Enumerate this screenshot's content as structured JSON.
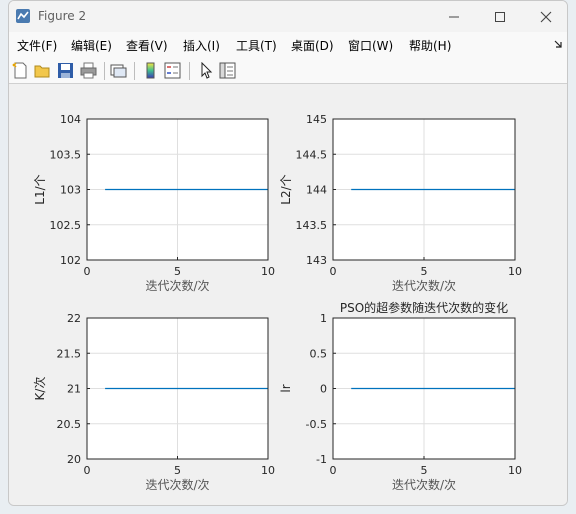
{
  "window": {
    "title": "Figure 2"
  },
  "menu": [
    "文件(F)",
    "编辑(E)",
    "查看(V)",
    "插入(I)",
    "工具(T)",
    "桌面(D)",
    "窗口(W)",
    "帮助(H)"
  ],
  "toolbar_icons": [
    "new-figure-icon",
    "open-file-icon",
    "save-icon",
    "print-icon",
    "link-plot-icon",
    "colorbar-icon",
    "legend-icon",
    "pointer-icon",
    "property-inspector-icon"
  ],
  "colors": {
    "line": "#0072bd",
    "grid": "#dfdfdf"
  },
  "chart_data": [
    {
      "type": "line",
      "title": "",
      "xlabel": "迭代次数/次",
      "ylabel": "L1/个",
      "xlim": [
        0,
        10
      ],
      "ylim": [
        102,
        104
      ],
      "xticks": [
        "0",
        "5",
        "10"
      ],
      "yticks": [
        "102",
        "102.5",
        "103",
        "103.5",
        "104"
      ],
      "grid": true,
      "series": [
        {
          "x": [
            1,
            2,
            3,
            4,
            5,
            6,
            7,
            8,
            9,
            10
          ],
          "values": [
            103,
            103,
            103,
            103,
            103,
            103,
            103,
            103,
            103,
            103
          ]
        }
      ]
    },
    {
      "type": "line",
      "title": "",
      "xlabel": "迭代次数/次",
      "ylabel": "L2/个",
      "xlim": [
        0,
        10
      ],
      "ylim": [
        143,
        145
      ],
      "xticks": [
        "0",
        "5",
        "10"
      ],
      "yticks": [
        "143",
        "143.5",
        "144",
        "144.5",
        "145"
      ],
      "grid": true,
      "series": [
        {
          "x": [
            1,
            2,
            3,
            4,
            5,
            6,
            7,
            8,
            9,
            10
          ],
          "values": [
            144,
            144,
            144,
            144,
            144,
            144,
            144,
            144,
            144,
            144
          ]
        }
      ]
    },
    {
      "type": "line",
      "title": "",
      "xlabel": "迭代次数/次",
      "ylabel": "K/次",
      "xlim": [
        0,
        10
      ],
      "ylim": [
        20,
        22
      ],
      "xticks": [
        "0",
        "5",
        "10"
      ],
      "yticks": [
        "20",
        "20.5",
        "21",
        "21.5",
        "22"
      ],
      "grid": true,
      "series": [
        {
          "x": [
            1,
            2,
            3,
            4,
            5,
            6,
            7,
            8,
            9,
            10
          ],
          "values": [
            21,
            21,
            21,
            21,
            21,
            21,
            21,
            21,
            21,
            21
          ]
        }
      ]
    },
    {
      "type": "line",
      "title": "PSO的超参数随迭代次数的变化",
      "xlabel": "迭代次数/次",
      "ylabel": "lr",
      "xlim": [
        0,
        10
      ],
      "ylim": [
        -1,
        1
      ],
      "xticks": [
        "0",
        "5",
        "10"
      ],
      "yticks": [
        "-1",
        "-0.5",
        "0",
        "0.5",
        "1"
      ],
      "grid": true,
      "series": [
        {
          "x": [
            1,
            2,
            3,
            4,
            5,
            6,
            7,
            8,
            9,
            10
          ],
          "values": [
            0,
            0,
            0,
            0,
            0,
            0,
            0,
            0,
            0,
            0
          ]
        }
      ]
    }
  ]
}
